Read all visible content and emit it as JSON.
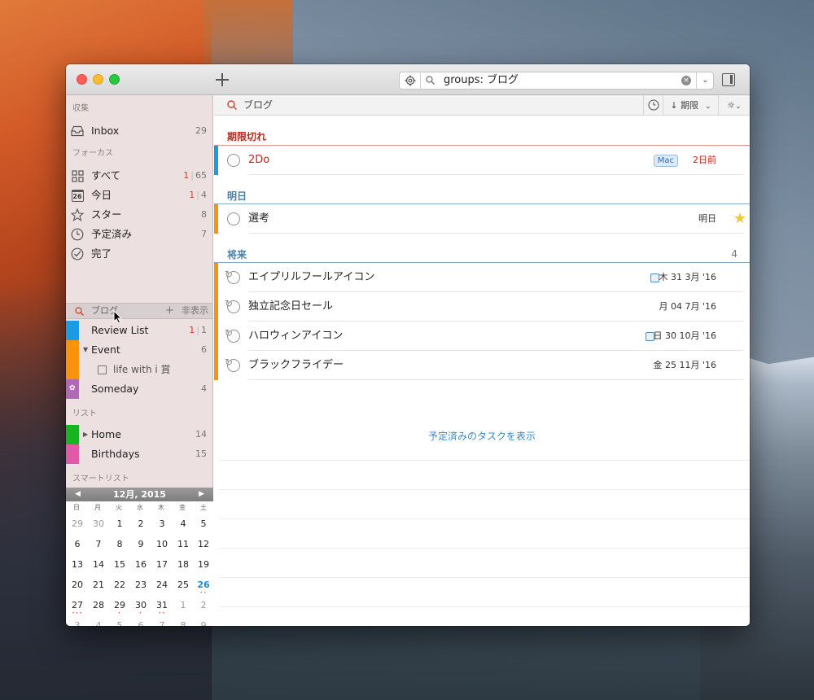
{
  "window": {
    "search_text": "groups: ブログ",
    "search_clear": "×",
    "search_dropdown": "⌄"
  },
  "sidebar": {
    "sections": {
      "collect": "収集",
      "focus": "フォーカス",
      "lists": "リスト",
      "smart_lists": "スマートリスト"
    },
    "inbox": {
      "label": "Inbox",
      "count": "29"
    },
    "focus_items": [
      {
        "label": "すべて",
        "count_red": "1",
        "count": "65"
      },
      {
        "label": "今日",
        "count_red": "1",
        "count": "4",
        "icon_text": "26"
      },
      {
        "label": "スター",
        "count": "8"
      },
      {
        "label": "予定済み",
        "count": "7"
      },
      {
        "label": "完了"
      }
    ],
    "group": {
      "name": "ブログ",
      "add": "+",
      "hide": "非表示"
    },
    "group_items": [
      {
        "label": "Review List",
        "count_red": "1",
        "count": "1",
        "color": "#1a9be6"
      },
      {
        "label": "Event",
        "count": "6",
        "color": "#f7940c"
      },
      {
        "label": "life with i 賞",
        "color": "#f7940c"
      },
      {
        "label": "Someday",
        "count": "4",
        "color": "#b06ab3"
      }
    ],
    "lists": [
      {
        "label": "Home",
        "count": "14",
        "color": "#16b322"
      },
      {
        "label": "Birthdays",
        "count": "15",
        "color": "#e25aa7"
      }
    ],
    "calendar": {
      "month_label": "12月, 2015",
      "weekdays": [
        "日",
        "月",
        "火",
        "水",
        "木",
        "金",
        "土"
      ],
      "weeks": [
        [
          "29",
          "30",
          "1",
          "2",
          "3",
          "4",
          "5"
        ],
        [
          "6",
          "7",
          "8",
          "9",
          "10",
          "11",
          "12"
        ],
        [
          "13",
          "14",
          "15",
          "16",
          "17",
          "18",
          "19"
        ],
        [
          "20",
          "21",
          "22",
          "23",
          "24",
          "25",
          "26"
        ],
        [
          "27",
          "28",
          "29",
          "30",
          "31",
          "1",
          "2"
        ],
        [
          "3",
          "4",
          "5",
          "6",
          "7",
          "8",
          "9"
        ]
      ],
      "today": "26"
    }
  },
  "main": {
    "header_title": "ブログ",
    "sort_label": "↓ 期限",
    "sections": [
      {
        "title": "期限切れ",
        "color": "#c0241b"
      },
      {
        "title": "明日",
        "color": "#4a7fa8"
      },
      {
        "title": "将来",
        "color": "#4a7fa8",
        "count": "4"
      }
    ],
    "tasks": {
      "overdue": [
        {
          "title": "2Do",
          "tag": "Mac",
          "due": "2日前",
          "color": "#1a9be6"
        }
      ],
      "tomorrow": [
        {
          "title": "選考",
          "due": "明日",
          "starred": true,
          "color": "#f7940c"
        }
      ],
      "future": [
        {
          "title": "エイプリルフールアイコン",
          "due": "木 31 3月 '16",
          "has_note": true,
          "color": "#f7940c"
        },
        {
          "title": "独立記念日セール",
          "due": "月 04 7月 '16",
          "color": "#f7940c"
        },
        {
          "title": "ハロウィンアイコン",
          "due": "日 30 10月 '16",
          "has_note": true,
          "color": "#f7940c"
        },
        {
          "title": "ブラックフライデー",
          "due": "金 25 11月 '16",
          "color": "#f7940c"
        }
      ]
    },
    "show_scheduled_link": "予定済みのタスクを表示"
  }
}
